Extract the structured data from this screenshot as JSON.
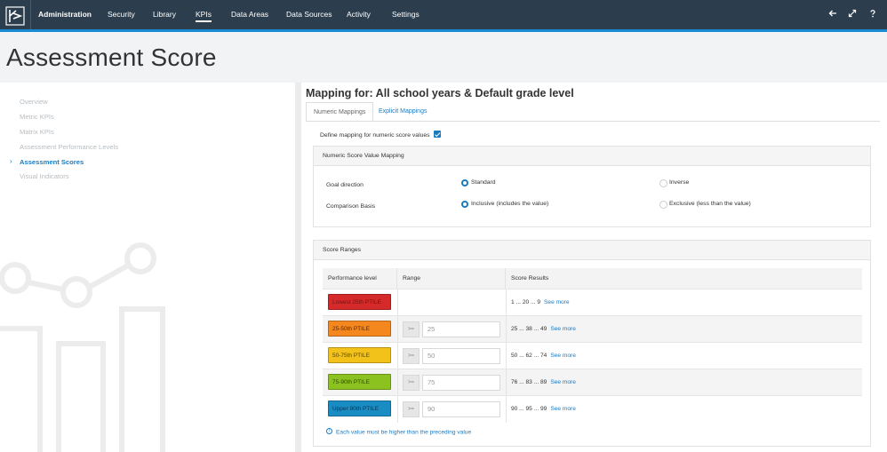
{
  "nav": {
    "items": [
      {
        "label": "Administration",
        "name": "nav-administration"
      },
      {
        "label": "Security",
        "name": "nav-security"
      },
      {
        "label": "Library",
        "name": "nav-library"
      },
      {
        "label": "KPIs",
        "name": "nav-kpis"
      },
      {
        "label": "Data Areas",
        "name": "nav-data-areas"
      },
      {
        "label": "Data Sources",
        "name": "nav-data-sources"
      },
      {
        "label": "Activity",
        "name": "nav-activity"
      },
      {
        "label": "Settings",
        "name": "nav-settings"
      }
    ],
    "active": "KPIs",
    "icons": [
      "back-arrow-icon",
      "expand-icon",
      "help-icon"
    ]
  },
  "page": {
    "title": "Assessment Score"
  },
  "sidebar": {
    "items": [
      {
        "label": "Overview"
      },
      {
        "label": "Metric KPIs"
      },
      {
        "label": "Matrix KPIs"
      },
      {
        "label": "Assessment Performance Levels"
      },
      {
        "label": "Assessment Scores"
      },
      {
        "label": "Visual Indicators"
      }
    ],
    "active": "Assessment Scores"
  },
  "main": {
    "title": "Mapping for: All school years & Default grade level",
    "tabs": [
      {
        "label": "Numeric Mappings",
        "active": true
      },
      {
        "label": "Explicit Mappings",
        "active": false
      }
    ],
    "define_label": "Define mapping for numeric score values",
    "define_checked": true,
    "value_mapping": {
      "header": "Numeric Score Value Mapping",
      "goal_label": "Goal direction",
      "goal_options": [
        "Standard",
        "Inverse"
      ],
      "goal_selected": "Standard",
      "basis_label": "Comparison Basis",
      "basis_options": [
        "Inclusive (includes the value)",
        "Exclusive (less than the value)"
      ],
      "basis_selected": "Inclusive (includes the value)"
    },
    "score_ranges": {
      "header": "Score Ranges",
      "columns": [
        "Performance level",
        "Range",
        "Score Results"
      ],
      "operator": ">=",
      "see_more": "See more",
      "rows": [
        {
          "level": "Lowest 25th PTILE",
          "color": "#d42a2a",
          "text_color": "#7a1010",
          "range": "",
          "results": "1 ... 20 ... 9"
        },
        {
          "level": "25-50th PTILE",
          "color": "#f5871f",
          "text_color": "#5a2a00",
          "range": "25",
          "results": "25 ... 38 ... 49"
        },
        {
          "level": "50-75th PTILE",
          "color": "#f2c21b",
          "text_color": "#5a4400",
          "range": "50",
          "results": "50 ... 62 ... 74"
        },
        {
          "level": "75-90th PTILE",
          "color": "#8cc21f",
          "text_color": "#2e4a00",
          "range": "75",
          "results": "76 ... 83 ... 89"
        },
        {
          "level": "Upper 90th PTILE",
          "color": "#1a8cc4",
          "text_color": "#0a3550",
          "range": "90",
          "results": "90 ... 95 ... 99"
        }
      ],
      "note": "Each value must be higher than the preceding value"
    }
  },
  "colors": {
    "topbar": "#2c3e4e",
    "accent": "#1a7bc1"
  }
}
